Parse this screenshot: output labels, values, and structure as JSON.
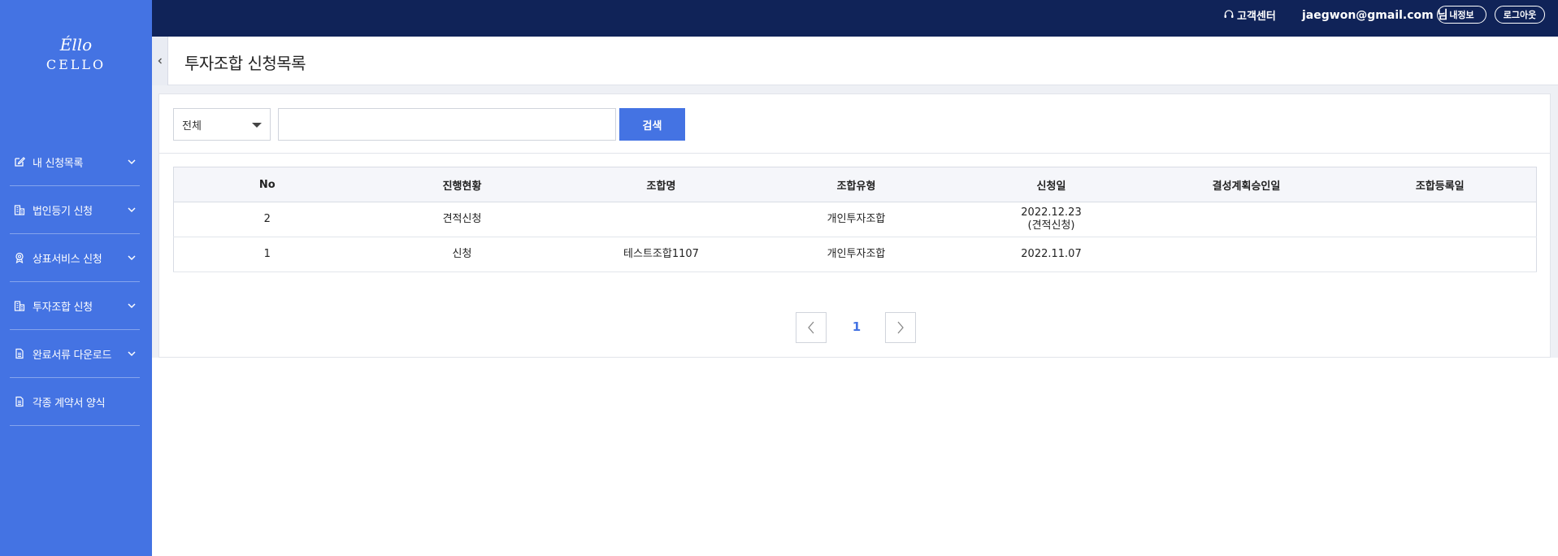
{
  "brand": {
    "logo_script": "Éllo",
    "logo_word": "CELLO",
    "color": "#4473e3",
    "topbar_color": "#102358"
  },
  "sidebar": {
    "items": [
      {
        "label": "내 신청목록",
        "icon": "edit-icon",
        "has_submenu": true
      },
      {
        "label": "법인등기 신청",
        "icon": "building-icon",
        "has_submenu": true
      },
      {
        "label": "상표서비스 신청",
        "icon": "award-icon",
        "has_submenu": true
      },
      {
        "label": "투자조합 신청",
        "icon": "building-icon",
        "has_submenu": true
      },
      {
        "label": "완료서류 다운로드",
        "icon": "document-icon",
        "has_submenu": true
      },
      {
        "label": "각종 계약서 양식",
        "icon": "document-icon",
        "has_submenu": false
      }
    ]
  },
  "topbar": {
    "customer_center": "고객센터",
    "user_email": "jaegwon@gmail.com 님",
    "my_info": "내정보",
    "logout": "로그아웃"
  },
  "page": {
    "title": "투자조합 신청목록"
  },
  "search": {
    "select_value": "전체",
    "input_value": "",
    "button_label": "검색"
  },
  "table": {
    "columns": [
      "No",
      "진행현황",
      "조합명",
      "조합유형",
      "신청일",
      "결성계획승인일",
      "조합등록일"
    ],
    "rows": [
      {
        "no": "2",
        "status": "견적신청",
        "name": "",
        "type": "개인투자조합",
        "date": "2022.12.23",
        "date_note": "(견적신청)",
        "approval": "",
        "registered": ""
      },
      {
        "no": "1",
        "status": "신청",
        "name": "테스트조합1107",
        "type": "개인투자조합",
        "date": "2022.11.07",
        "date_note": "",
        "approval": "",
        "registered": ""
      }
    ]
  },
  "pagination": {
    "current_page": "1"
  }
}
